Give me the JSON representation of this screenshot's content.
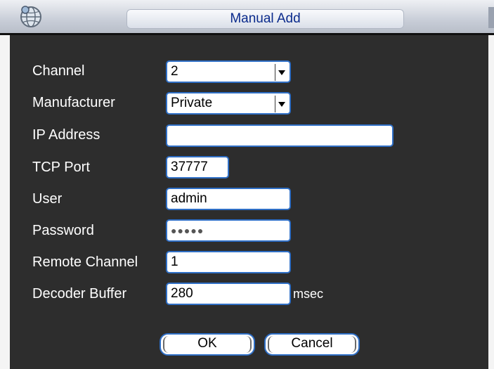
{
  "window": {
    "title": "Manual Add",
    "icon": "gear-globe-icon"
  },
  "form": {
    "channel": {
      "label": "Channel",
      "value": "2"
    },
    "manufacturer": {
      "label": "Manufacturer",
      "value": "Private"
    },
    "ip_address": {
      "label": "IP Address",
      "value": ""
    },
    "tcp_port": {
      "label": "TCP Port",
      "value": "37777"
    },
    "user": {
      "label": "User",
      "value": "admin"
    },
    "password": {
      "label": "Password",
      "value": "●●●●●"
    },
    "remote_channel": {
      "label": "Remote Channel",
      "value": "1"
    },
    "decoder_buffer": {
      "label": "Decoder Buffer",
      "value": "280",
      "unit": "msec"
    }
  },
  "buttons": {
    "ok": "OK",
    "cancel": "Cancel"
  },
  "colors": {
    "panel_bg": "#2d2d2d",
    "field_border": "#2f6fc6",
    "title_text": "#0b2b8c"
  }
}
